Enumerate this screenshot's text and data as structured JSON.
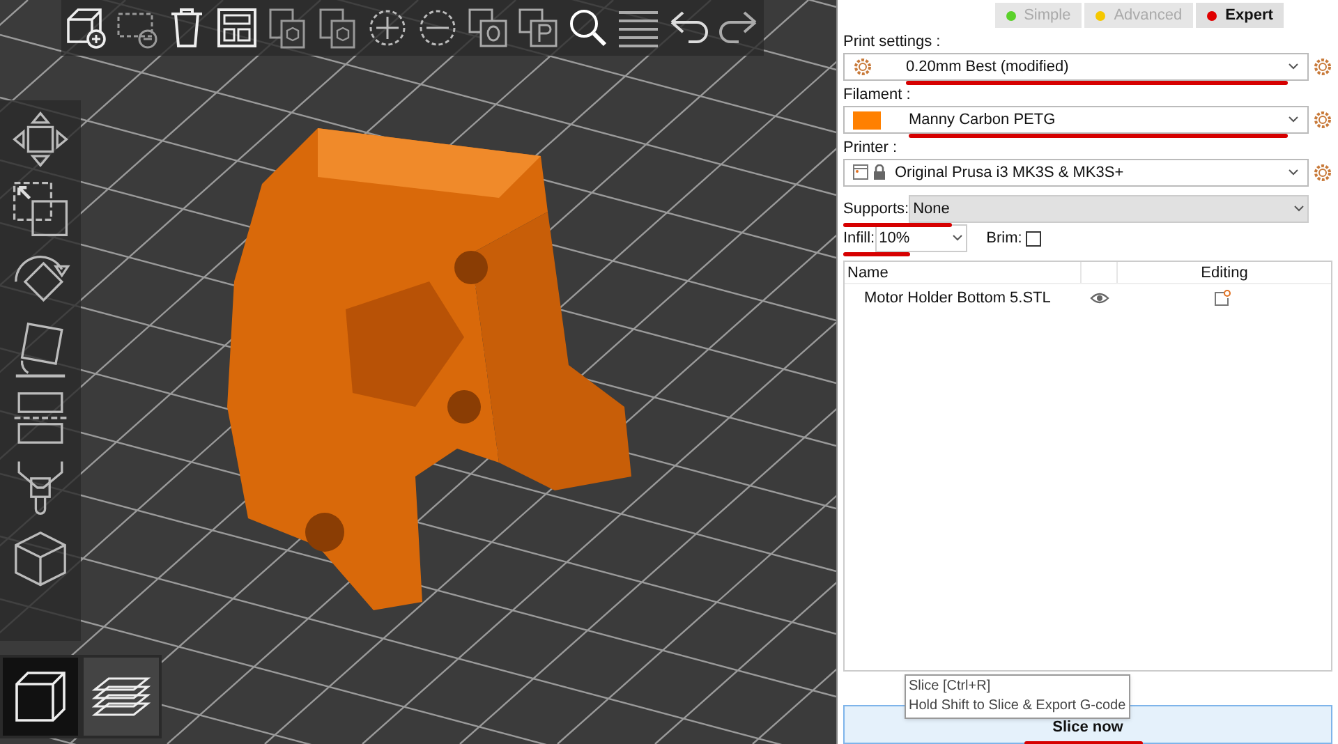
{
  "mode_tabs": [
    {
      "label": "Simple",
      "selected": false,
      "color": "#5ad12a"
    },
    {
      "label": "Advanced",
      "selected": false,
      "color": "#f5c800"
    },
    {
      "label": "Expert",
      "selected": true,
      "color": "#e00000"
    }
  ],
  "print_settings": {
    "label": "Print settings :",
    "value": "0.20mm Best (modified)"
  },
  "filament": {
    "label": "Filament :",
    "value": "Manny Carbon PETG",
    "color": "#ff8000"
  },
  "printer": {
    "label": "Printer :",
    "value": "Original Prusa i3 MK3S & MK3S+"
  },
  "supports": {
    "label": "Supports:",
    "value": "None"
  },
  "infill": {
    "label": "Infill:",
    "value": "10%"
  },
  "brim": {
    "label": "Brim:",
    "checked": false
  },
  "object_list": {
    "columns": [
      "Name",
      "Editing"
    ],
    "rows": [
      {
        "name": "Motor Holder Bottom 5.STL"
      }
    ]
  },
  "tooltip": {
    "lines": [
      "Slice [Ctrl+R]",
      "Hold Shift to Slice & Export G-code"
    ]
  },
  "slice_button": {
    "label": "Slice now"
  },
  "view_buttons": [
    {
      "kind": "cube",
      "selected": true
    },
    {
      "kind": "layers",
      "selected": false
    }
  ]
}
